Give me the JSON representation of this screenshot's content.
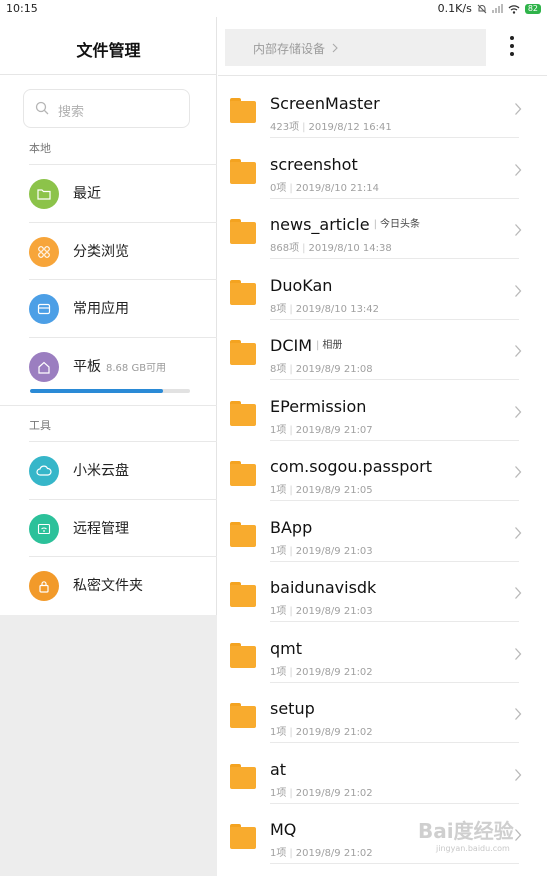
{
  "status_bar": {
    "time": "10:15",
    "net_speed": "0.1K/s",
    "battery": "82",
    "colors": {
      "battery": "#2fb34a"
    }
  },
  "sidebar": {
    "title": "文件管理",
    "search_placeholder": "搜索",
    "section_local": "本地",
    "section_tools": "工具",
    "items": [
      {
        "label": "最近",
        "icon": "folder-icon",
        "color": "#8cc34a"
      },
      {
        "label": "分类浏览",
        "icon": "grid-icon",
        "color": "#f7a53a"
      },
      {
        "label": "常用应用",
        "icon": "app-box-icon",
        "color": "#4c9fe6"
      },
      {
        "label": "平板",
        "icon": "home-icon",
        "color": "#9b7ec0",
        "subtitle": "8.68 GB可用",
        "usage_fraction": 0.83
      },
      {
        "label": "小米云盘",
        "icon": "cloud-icon",
        "color": "#36b6c9"
      },
      {
        "label": "远程管理",
        "icon": "wifi-icon",
        "color": "#2cc19a"
      },
      {
        "label": "私密文件夹",
        "icon": "lock-icon",
        "color": "#f29a2a"
      }
    ]
  },
  "main": {
    "breadcrumb": "内部存储设备",
    "files": [
      {
        "name": "ScreenMaster",
        "tag": "",
        "count": "423项",
        "date": "2019/8/12 16:41"
      },
      {
        "name": "screenshot",
        "tag": "",
        "count": "0项",
        "date": "2019/8/10 21:14"
      },
      {
        "name": "news_article",
        "tag": "今日头条",
        "count": "868项",
        "date": "2019/8/10 14:38"
      },
      {
        "name": "DuoKan",
        "tag": "",
        "count": "8项",
        "date": "2019/8/10 13:42"
      },
      {
        "name": "DCIM",
        "tag": "相册",
        "count": "8项",
        "date": "2019/8/9 21:08"
      },
      {
        "name": "EPermission",
        "tag": "",
        "count": "1项",
        "date": "2019/8/9 21:07"
      },
      {
        "name": "com.sogou.passport",
        "tag": "",
        "count": "1项",
        "date": "2019/8/9 21:05"
      },
      {
        "name": "BApp",
        "tag": "",
        "count": "1项",
        "date": "2019/8/9 21:03"
      },
      {
        "name": "baidunavisdk",
        "tag": "",
        "count": "1项",
        "date": "2019/8/9 21:03"
      },
      {
        "name": "qmt",
        "tag": "",
        "count": "1项",
        "date": "2019/8/9 21:02"
      },
      {
        "name": "setup",
        "tag": "",
        "count": "1项",
        "date": "2019/8/9 21:02"
      },
      {
        "name": "at",
        "tag": "",
        "count": "1项",
        "date": "2019/8/9 21:02"
      },
      {
        "name": "MQ",
        "tag": "",
        "count": "1项",
        "date": "2019/8/9 21:02"
      }
    ],
    "colors": {
      "folder": "#f8ab2e"
    }
  },
  "watermark": {
    "text": "Bai度经验",
    "sub": "jingyan.baidu.com"
  }
}
